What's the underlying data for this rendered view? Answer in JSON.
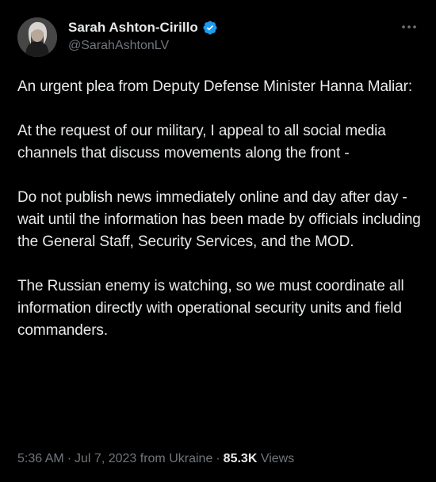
{
  "author": {
    "display_name": "Sarah Ashton-Cirillo",
    "handle": "@SarahAshtonLV",
    "verified": true,
    "verified_color": "#1d9bf0"
  },
  "tweet": {
    "paragraphs": [
      "An urgent plea from Deputy Defense Minister Hanna Maliar:",
      "At the request of our military, I appeal to all social media channels that discuss movements along the front -",
      "Do not publish news immediately online and day after day - wait until the information has been made by officials including the General Staff, Security Services, and the MOD.",
      "The Russian enemy is watching, so we must coordinate all information directly with operational security units and field commanders."
    ]
  },
  "meta": {
    "time": "5:36 AM",
    "separator": "·",
    "date_location": "Jul 7, 2023 from Ukraine",
    "views_count": "85.3K",
    "views_label": "Views"
  },
  "icons": {
    "more": "more-horizontal-icon",
    "verified": "verified-badge-icon"
  }
}
